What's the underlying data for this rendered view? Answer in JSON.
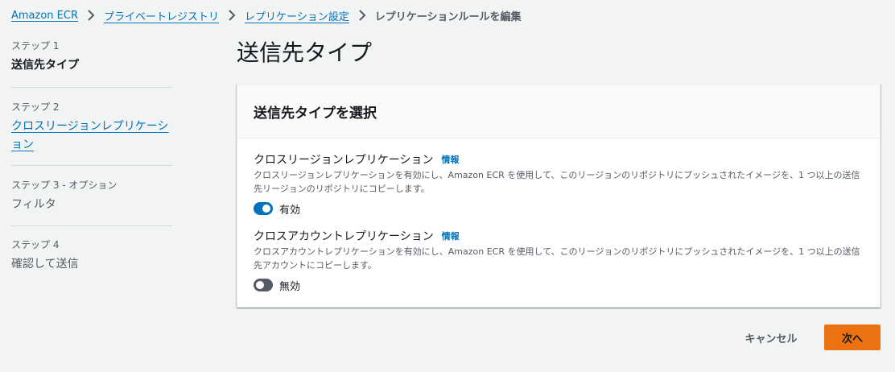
{
  "breadcrumb": {
    "items": [
      "Amazon ECR",
      "プライベートレジストリ",
      "レプリケーション設定"
    ],
    "current": "レプリケーションルールを編集"
  },
  "steps": [
    {
      "label": "ステップ 1",
      "title": "送信先タイプ"
    },
    {
      "label": "ステップ 2",
      "title": "クロスリージョンレプリケーション"
    },
    {
      "label": "ステップ 3 - オプション",
      "title": "フィルタ"
    },
    {
      "label": "ステップ 4",
      "title": "確認して送信"
    }
  ],
  "page_title": "送信先タイプ",
  "panel": {
    "title": "送信先タイプを選択",
    "options": [
      {
        "title": "クロスリージョンレプリケーション",
        "info": "情報",
        "description": "クロスリージョンレプリケーションを有効にし、Amazon ECR を使用して、このリージョンのリポジトリにプッシュされたイメージを、1 つ以上の送信先リージョンのリポジトリにコピーします。",
        "toggle_label": "有効",
        "enabled": true
      },
      {
        "title": "クロスアカウントレプリケーション",
        "info": "情報",
        "description": "クロスアカウントレプリケーションを有効にし、Amazon ECR を使用して、このリージョンのリポジトリにプッシュされたイメージを、1 つ以上の送信先アカウントにコピーします。",
        "toggle_label": "無効",
        "enabled": false
      }
    ]
  },
  "actions": {
    "cancel": "キャンセル",
    "next": "次へ"
  },
  "colors": {
    "link": "#0073bb",
    "primary": "#ec7211",
    "background": "#f2f3f3"
  }
}
